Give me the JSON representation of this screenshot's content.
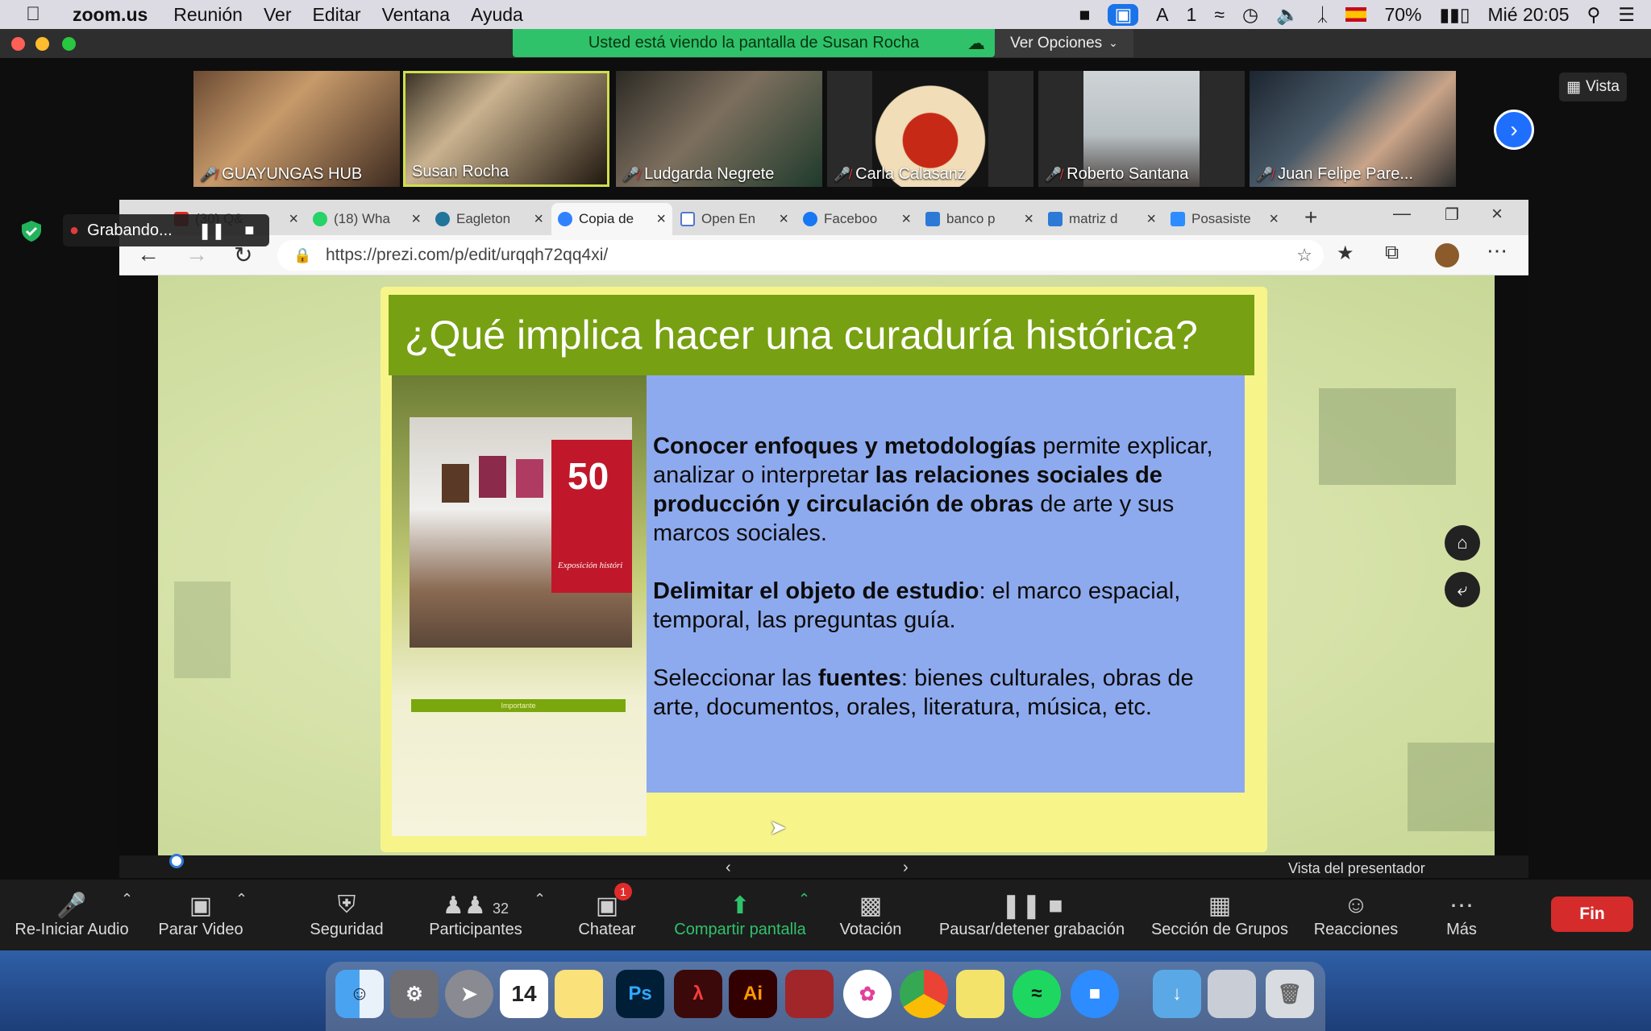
{
  "menubar": {
    "app_name": "zoom.us",
    "menus": [
      "Reunión",
      "Ver",
      "Editar",
      "Ventana",
      "Ayuda"
    ],
    "battery": "70%",
    "clock": "Mié 20:05",
    "input_indicator": "1"
  },
  "zoom": {
    "share_banner": "Usted está viendo la pantalla de Susan Rocha",
    "view_options": "Ver Opciones",
    "view_button": "Vista",
    "recording_label": "Grabando...",
    "participants": [
      {
        "name": "GUAYUNGAS HUB",
        "muted": true
      },
      {
        "name": "Susan Rocha",
        "muted": false
      },
      {
        "name": "Ludgarda Negrete",
        "muted": true
      },
      {
        "name": "Carla Calasanz",
        "muted": true
      },
      {
        "name": "Roberto Santana",
        "muted": true
      },
      {
        "name": "Juan Felipe Pare...",
        "muted": true
      }
    ],
    "toolbar": {
      "audio": "Re-Iniciar Audio",
      "video": "Parar Video",
      "security": "Seguridad",
      "participants": "Participantes",
      "participants_count": "32",
      "chat": "Chatear",
      "chat_badge": "1",
      "share": "Compartir pantalla",
      "poll": "Votación",
      "recording": "Pausar/detener grabación",
      "breakout": "Sección de Grupos",
      "reactions": "Reacciones",
      "more": "Más",
      "end": "Fin"
    }
  },
  "browser": {
    "tabs": [
      {
        "label": "(30) Q&",
        "color": "#e02626",
        "active": false
      },
      {
        "label": "(18) Wha",
        "color": "#25d366",
        "active": false
      },
      {
        "label": "Eagleton",
        "color": "#21759b",
        "active": false
      },
      {
        "label": "Copia de",
        "color": "#3181ff",
        "active": true
      },
      {
        "label": "Open En",
        "color": "#5577cc",
        "active": false
      },
      {
        "label": "Faceboo",
        "color": "#1877f2",
        "active": false
      },
      {
        "label": "banco p",
        "color": "#2d7ad6",
        "active": false
      },
      {
        "label": "matriz d",
        "color": "#2d7ad6",
        "active": false
      },
      {
        "label": "Posasiste",
        "color": "#2d8cff",
        "active": false
      }
    ],
    "url": "https://prezi.com/p/edit/urqqh72qq4xi/",
    "presenter_view": "Vista del presentador"
  },
  "slide": {
    "title": "¿Qué implica hacer una curaduría histórica?",
    "p1_bold": "Conocer enfoques y metodologías",
    "p1_a": " permite explicar, analizar o interpreta",
    "p1_bold2": "r las relaciones sociales de producción y circulación de obras",
    "p1_b": " de arte y sus marcos sociales.",
    "p2_bold": "Delimitar el objeto de estudio",
    "p2_a": ": el marco espacial, temporal, las preguntas guía.",
    "p3_a": "Seleccionar las ",
    "p3_bold": "fuentes",
    "p3_b": ": bienes culturales, obras de arte, documentos, orales, literatura, música, etc.",
    "importante_label": "Importante",
    "poster_number": "50",
    "poster_caption": "Exposición históri"
  },
  "colors": {
    "zoom_green": "#2fc26b",
    "slide_title_bg": "#77a012",
    "slide_text_bg": "#8eaaee",
    "end_red": "#d52b2b"
  }
}
